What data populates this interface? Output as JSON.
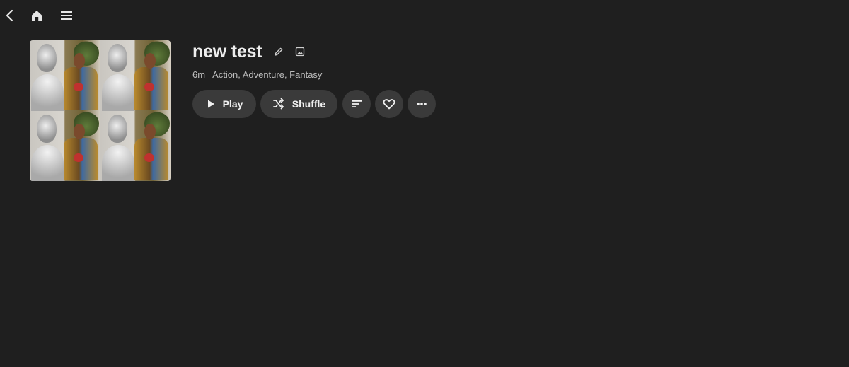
{
  "topbar": {
    "icons": [
      "back-arrow-icon",
      "home-icon",
      "menu-icon"
    ]
  },
  "album": {
    "title": "new test",
    "duration": "6m",
    "genres": "Action, Adventure, Fantasy"
  },
  "actions": {
    "play_label": "Play",
    "shuffle_label": "Shuffle",
    "icons": [
      "play-icon",
      "shuffle-icon",
      "sort-icon",
      "heart-icon",
      "more-icon"
    ]
  },
  "colors": {
    "background": "#1f1f1f",
    "button_bg": "#3a3a3a",
    "text": "#ededed",
    "meta_text": "#bdbdbd"
  }
}
